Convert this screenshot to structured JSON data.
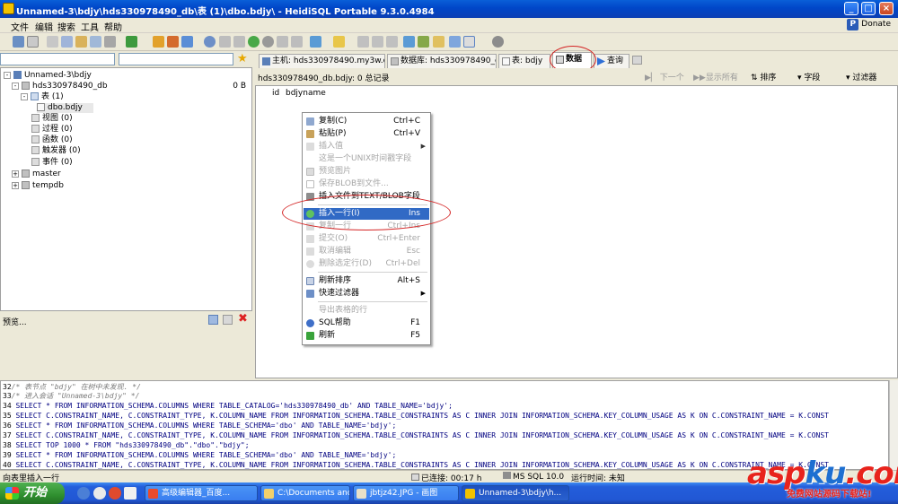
{
  "window": {
    "title": "Unnamed-3\\bdjy\\hds330978490_db\\表 (1)\\dbo.bdjy\\ - HeidiSQL Portable 9.3.0.4984",
    "minimize": "_",
    "maximize": "□",
    "close": "×"
  },
  "menu": {
    "items": [
      "文件",
      "编辑",
      "搜索",
      "工具",
      "帮助"
    ],
    "donate": "Donate",
    "donate_badge": "P"
  },
  "tree": {
    "root": "Unnamed-3\\bdjy",
    "db": "hds330978490_db",
    "db_size": "0 B",
    "tables": "表 (1)",
    "table_item": "dbo.bdjy",
    "views": "视图 (0)",
    "procs": "过程 (0)",
    "funcs": "函数 (0)",
    "triggers": "触发器 (0)",
    "events": "事件 (0)",
    "master": "master",
    "tempdb": "tempdb",
    "expand_minus": "-",
    "expand_plus": "+"
  },
  "preview": {
    "label": "预览..."
  },
  "tabs": [
    {
      "label": "主机: hds330978490.my3w.co"
    },
    {
      "label": "数据库: hds330978490_db"
    },
    {
      "label": "表: bdjy"
    },
    {
      "label": "数据"
    },
    {
      "label": "查询"
    }
  ],
  "data_header": {
    "record_info": "hds330978490_db.bdjy: 0 总记录",
    "next": "下一个",
    "show_all": "显示所有",
    "sort": "排序",
    "columns": "字段",
    "filter": "过滤器"
  },
  "grid": {
    "columns": [
      "id",
      "bdjyname"
    ]
  },
  "context_menu": {
    "items": [
      {
        "label": "复制(C)",
        "shortcut": "Ctrl+C",
        "disabled": false,
        "highlight": false,
        "icon": "copy-icon"
      },
      {
        "label": "粘贴(P)",
        "shortcut": "Ctrl+V",
        "disabled": false,
        "highlight": false,
        "icon": "paste-icon"
      },
      {
        "label": "插入值",
        "shortcut": "",
        "disabled": true,
        "highlight": false,
        "icon": "insert-value-icon",
        "submenu": true
      },
      {
        "label": "这是一个UNIX时间戳字段",
        "shortcut": "",
        "disabled": true,
        "highlight": false,
        "icon": ""
      },
      {
        "label": "预览图片",
        "shortcut": "",
        "disabled": true,
        "highlight": false,
        "icon": "image-icon"
      },
      {
        "label": "保存BLOB到文件...",
        "shortcut": "",
        "disabled": true,
        "highlight": false,
        "icon": "save-icon"
      },
      {
        "label": "插入文件到TEXT/BLOB字段",
        "shortcut": "",
        "disabled": false,
        "highlight": false,
        "icon": "insert-file-icon"
      },
      {
        "label": "插入一行(I)",
        "shortcut": "Ins",
        "disabled": false,
        "highlight": true,
        "icon": "add-row-icon"
      },
      {
        "label": "复制一行",
        "shortcut": "Ctrl+Ins",
        "disabled": true,
        "highlight": false,
        "icon": "duplicate-row-icon"
      },
      {
        "label": "提交(O)",
        "shortcut": "Ctrl+Enter",
        "disabled": true,
        "highlight": false,
        "icon": "commit-icon"
      },
      {
        "label": "取消编辑",
        "shortcut": "Esc",
        "disabled": true,
        "highlight": false,
        "icon": "cancel-icon"
      },
      {
        "label": "删除选定行(D)",
        "shortcut": "Ctrl+Del",
        "disabled": true,
        "highlight": false,
        "icon": "delete-row-icon"
      },
      {
        "label": "刷新排序",
        "shortcut": "Alt+S",
        "disabled": false,
        "highlight": false,
        "icon": "refresh-sort-icon"
      },
      {
        "label": "快速过滤器",
        "shortcut": "",
        "disabled": false,
        "highlight": false,
        "icon": "filter-icon",
        "submenu": true
      },
      {
        "label": "导出表格的行",
        "shortcut": "",
        "disabled": true,
        "highlight": false,
        "icon": ""
      },
      {
        "label": "SQL帮助",
        "shortcut": "F1",
        "disabled": false,
        "highlight": false,
        "icon": "help-icon"
      },
      {
        "label": "刷新",
        "shortcut": "F5",
        "disabled": false,
        "highlight": false,
        "icon": "refresh-icon"
      }
    ],
    "submenu_arrow": "▶"
  },
  "sql_log": [
    {
      "n": "32",
      "text": "/* 表节点 \"bdjy\" 在树中未发现. */",
      "comment": true
    },
    {
      "n": "33",
      "text": "/* 进入会话 \"Unnamed-3\\bdjy\" */",
      "comment": true
    },
    {
      "n": "34",
      "text": "SELECT * FROM INFORMATION_SCHEMA.COLUMNS WHERE TABLE_CATALOG='hds330978490_db' AND TABLE_NAME='bdjy';",
      "comment": false
    },
    {
      "n": "35",
      "text": "SELECT C.CONSTRAINT_NAME, C.CONSTRAINT_TYPE, K.COLUMN_NAME FROM INFORMATION_SCHEMA.TABLE_CONSTRAINTS AS C INNER JOIN INFORMATION_SCHEMA.KEY_COLUMN_USAGE AS K ON C.CONSTRAINT_NAME = K.CONST",
      "comment": false
    },
    {
      "n": "36",
      "text": "SELECT * FROM INFORMATION_SCHEMA.COLUMNS WHERE TABLE_SCHEMA='dbo' AND TABLE_NAME='bdjy';",
      "comment": false
    },
    {
      "n": "37",
      "text": "SELECT C.CONSTRAINT_NAME, C.CONSTRAINT_TYPE, K.COLUMN_NAME FROM INFORMATION_SCHEMA.TABLE_CONSTRAINTS AS C INNER JOIN INFORMATION_SCHEMA.KEY_COLUMN_USAGE AS K ON C.CONSTRAINT_NAME = K.CONST",
      "comment": false
    },
    {
      "n": "38",
      "text": "SELECT TOP 1000 * FROM \"hds330978490_db\".\"dbo\".\"bdjy\";",
      "comment": false
    },
    {
      "n": "39",
      "text": "SELECT * FROM INFORMATION_SCHEMA.COLUMNS WHERE TABLE_SCHEMA='dbo' AND TABLE_NAME='bdjy';",
      "comment": false
    },
    {
      "n": "40",
      "text": "SELECT C.CONSTRAINT_NAME, C.CONSTRAINT_TYPE, K.COLUMN_NAME FROM INFORMATION_SCHEMA.TABLE_CONSTRAINTS AS C INNER JOIN INFORMATION_SCHEMA.KEY_COLUMN_USAGE AS K ON C.CONSTRAINT_NAME = K.CONST",
      "comment": false
    }
  ],
  "status": {
    "hint": "向表里插入一行",
    "connected": "已连接: 00:17 h",
    "server": "MS SQL 10.0",
    "runtime": "运行时间: 未知"
  },
  "taskbar": {
    "start": "开始",
    "items": [
      {
        "label": "高级编辑器_百度..."
      },
      {
        "label": "C:\\Documents and..."
      },
      {
        "label": "jbtjz42.JPG - 画图"
      },
      {
        "label": "Unnamed-3\\bdjy\\h..."
      }
    ]
  },
  "watermark": {
    "logo_a": "asp",
    "logo_k": "ku",
    "logo_end": ".com",
    "sub": "免费网站源码下载站!"
  }
}
